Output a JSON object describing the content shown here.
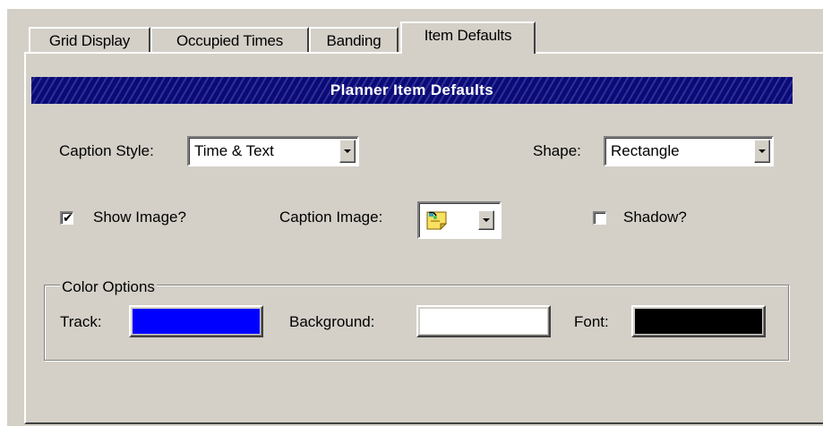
{
  "tabs": [
    {
      "label": "Grid Display"
    },
    {
      "label": "Occupied Times"
    },
    {
      "label": "Banding"
    },
    {
      "label": "Item Defaults",
      "active": true
    }
  ],
  "header": {
    "title": "Planner Item Defaults"
  },
  "caption_style": {
    "label": "Caption Style:",
    "value": "Time & Text"
  },
  "shape": {
    "label": "Shape:",
    "value": "Rectangle"
  },
  "show_image": {
    "label": "Show Image?",
    "checked": true,
    "mark": "✔"
  },
  "caption_image": {
    "label": "Caption Image:",
    "icon": "sticky-note-icon"
  },
  "shadow": {
    "label": "Shadow?",
    "checked": false
  },
  "color_options": {
    "title": "Color Options",
    "track": {
      "label": "Track:",
      "color": "#0000ff"
    },
    "background": {
      "label": "Background:",
      "color": "#ffffff"
    },
    "font": {
      "label": "Font:",
      "color": "#000000"
    }
  }
}
